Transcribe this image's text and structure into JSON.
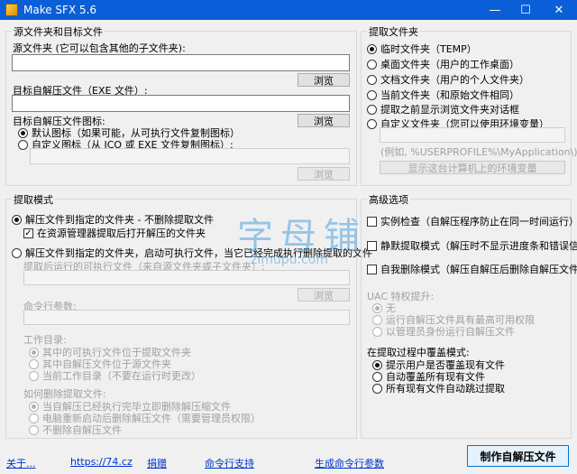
{
  "window": {
    "title": "Make SFX 5.6",
    "minimize": "—",
    "maximize": "☐",
    "close": "✕"
  },
  "source_target": {
    "group_title": "源文件夹和目标文件",
    "source_label": "源文件夹 (它可以包含其他的子文件夹):",
    "source_value": "",
    "browse1": "浏览",
    "target_label": "目标自解压文件（EXE 文件）:",
    "target_value": "",
    "browse2": "浏览",
    "icon_label": "目标自解压文件图标:",
    "browse3": "浏览",
    "icon_default": "默认图标（如果可能，从可执行文件复制图标）",
    "icon_custom": "自定义图标（从 ICO 或 EXE 文件复制图标）:",
    "icon_path_value": "",
    "browse4": "浏览"
  },
  "extract_folder": {
    "group_title": "提取文件夹",
    "options": [
      "临时文件夹（TEMP）",
      "桌面文件夹（用户的工作桌面）",
      "文档文件夹（用户的个人文件夹）",
      "当前文件夹（和原始文件相同）",
      "提取之前显示浏览文件夹对话框",
      "自定义文件夹（您可以使用环境变量）"
    ],
    "selected_index": 0,
    "custom_value": "",
    "example_hint": "(例如, %USERPROFILE%\\MyApplication\\)",
    "show_env_button": "显示这台计算机上的环境变量"
  },
  "extract_mode": {
    "group_title": "提取模式",
    "mode1": "解压文件到指定的文件夹 - 不删除提取文件",
    "mode1_selected": true,
    "open_in_explorer": "在资源管理器提取后打开解压的文件夹",
    "open_in_explorer_checked": true,
    "mode2": "解压文件到指定的文件夹，启动可执行文件，当它已经完成执行删除提取的文件",
    "mode2_selected": false,
    "run_after_label": "提取后运行的可执行文件（来自源文件夹或子文件夹）:",
    "run_after_value": "",
    "browse5": "浏览",
    "cmd_label": "命令行参数:",
    "cmd_value": "",
    "workdir_label": "工作目录:",
    "workdir_options": [
      "其中的可执行文件位于提取文件夹",
      "其中自解压文件位于源文件夹",
      "当前工作目录（不要在运行时更改）"
    ],
    "delete_label": "如何删除提取文件:",
    "delete_options": [
      "当自解压已经执行完毕立即删除解压缩文件",
      "电脑重新启动后删除解压文件（需要管理员权限）",
      "不删除自解压文件"
    ]
  },
  "advanced": {
    "group_title": "高级选项",
    "single_instance": "实例检查（自解压程序防止在同一时间运行）",
    "silent": "静默提取模式（解压时不显示进度条和错误信息）",
    "self_delete": "自我删除模式（解压自解压后删除自解压文件）",
    "uac_label": "UAC 特权提升:",
    "uac_options": [
      "无",
      "运行自解压文件具有最高可用权限",
      "以管理员身份运行自解压文件"
    ],
    "overwrite_label": "在提取过程中覆盖模式:",
    "overwrite_options": [
      "提示用户是否覆盖现有文件",
      "自动覆盖所有现有文件",
      "所有现有文件自动跳过提取"
    ],
    "overwrite_selected": 0
  },
  "footer": {
    "about": "关于...",
    "website": "https://74.cz",
    "donate": "捐赠",
    "cmd_support": "命令行支持",
    "gen_cmd": "生成命令行参数",
    "make": "制作自解压文件"
  },
  "watermark": {
    "main": "字母铺",
    "sub": "zimupu.com"
  }
}
